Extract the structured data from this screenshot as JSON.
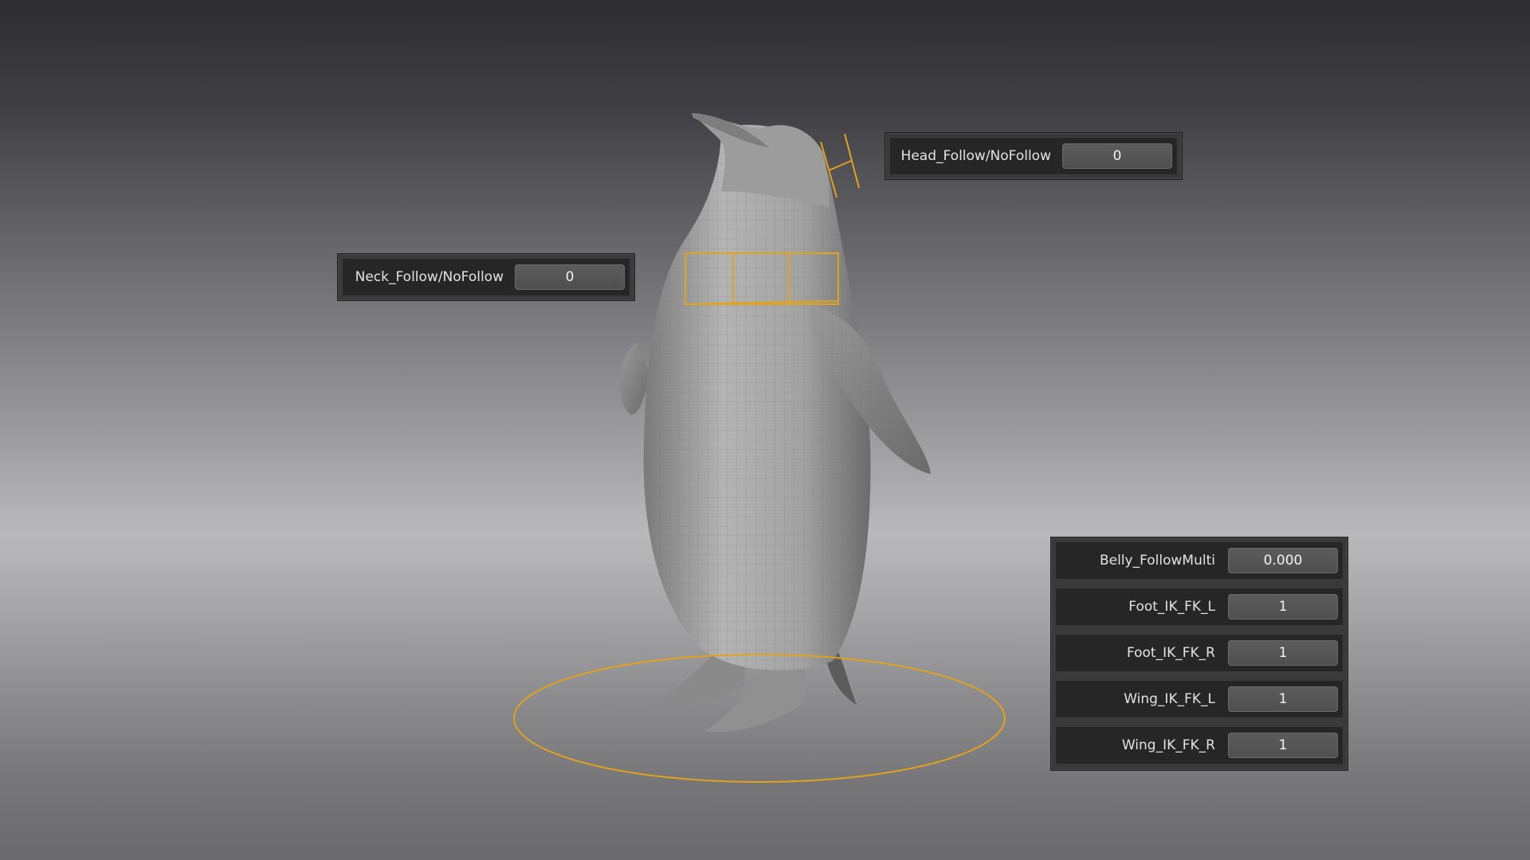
{
  "colors": {
    "rig_control": "#e2a21c",
    "panel_bg": "#3a3a3a",
    "row_bg": "#262626",
    "field_bg": "#565656"
  },
  "controls": {
    "head": {
      "label": "Head_Follow/NoFollow",
      "value": "0"
    },
    "neck": {
      "label": "Neck_Follow/NoFollow",
      "value": "0"
    },
    "properties": [
      {
        "label": "Belly_FollowMulti",
        "value": "0.000"
      },
      {
        "label": "Foot_IK_FK_L",
        "value": "1"
      },
      {
        "label": "Foot_IK_FK_R",
        "value": "1"
      },
      {
        "label": "Wing_IK_FK_L",
        "value": "1"
      },
      {
        "label": "Wing_IK_FK_R",
        "value": "1"
      }
    ]
  }
}
